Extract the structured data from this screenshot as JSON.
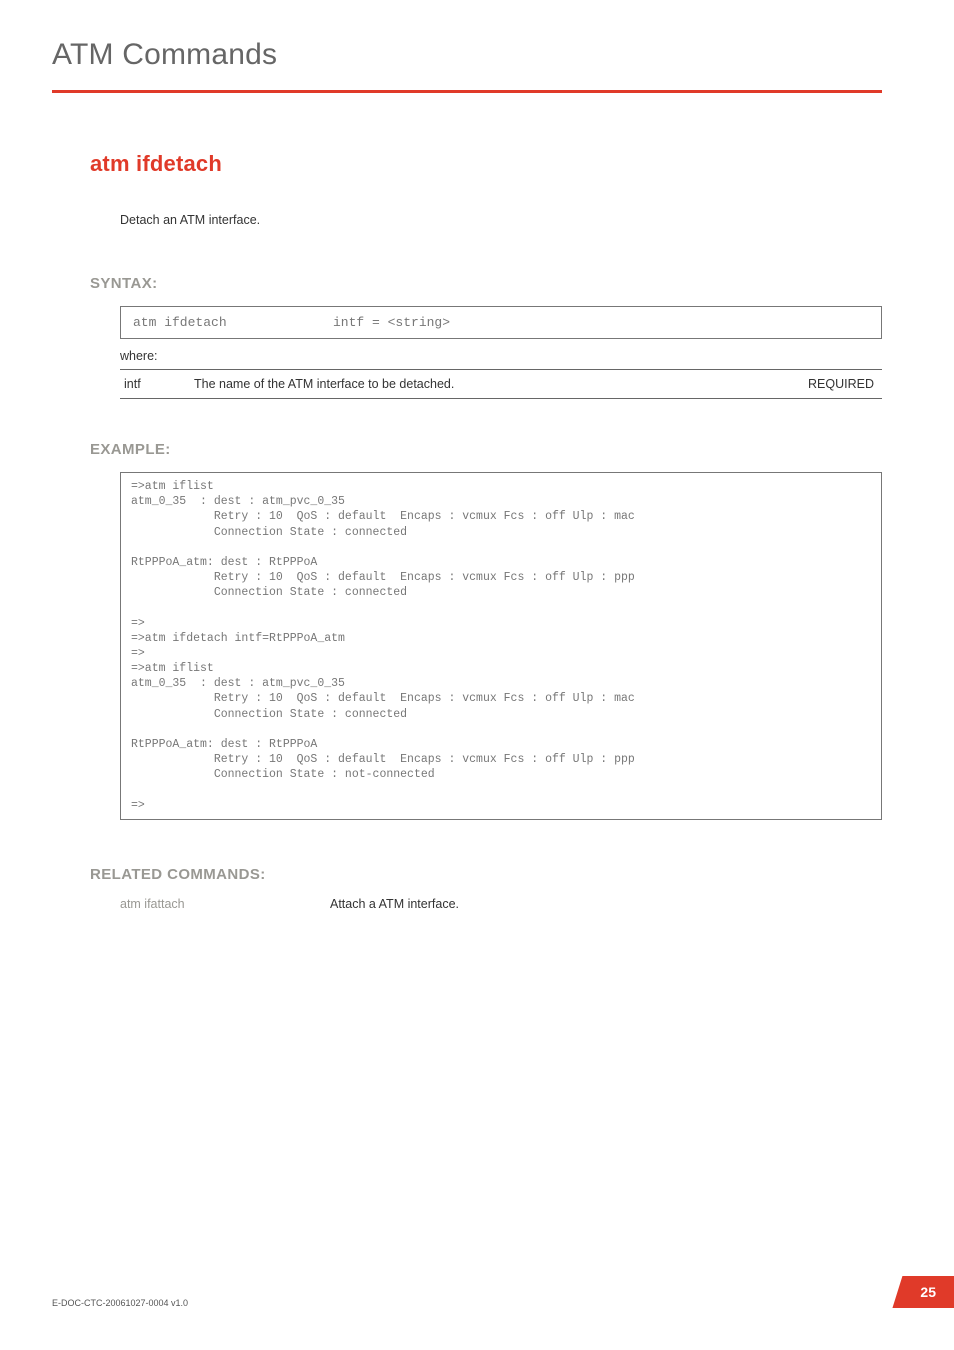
{
  "chapter_title": "ATM Commands",
  "command_name": "atm ifdetach",
  "description": "Detach an ATM interface.",
  "sections": {
    "syntax_head": "SYNTAX:",
    "example_head": "EXAMPLE:",
    "related_head": "RELATED COMMANDS:"
  },
  "syntax": {
    "left": "atm ifdetach",
    "right": "intf = <string>",
    "where_label": "where:",
    "param_name": "intf",
    "param_desc": "The name of the ATM interface to be detached.",
    "param_req": "REQUIRED"
  },
  "example_text": "=>atm iflist\natm_0_35  : dest : atm_pvc_0_35\n            Retry : 10  QoS : default  Encaps : vcmux Fcs : off Ulp : mac\n            Connection State : connected\n\nRtPPPoA_atm: dest : RtPPPoA\n            Retry : 10  QoS : default  Encaps : vcmux Fcs : off Ulp : ppp\n            Connection State : connected\n\n=>\n=>atm ifdetach intf=RtPPPoA_atm\n=>\n=>atm iflist\natm_0_35  : dest : atm_pvc_0_35\n            Retry : 10  QoS : default  Encaps : vcmux Fcs : off Ulp : mac\n            Connection State : connected\n\nRtPPPoA_atm: dest : RtPPPoA\n            Retry : 10  QoS : default  Encaps : vcmux Fcs : off Ulp : ppp\n            Connection State : not-connected\n\n=>",
  "related": {
    "cmd": "atm ifattach",
    "desc": "Attach a ATM interface."
  },
  "footer": {
    "doc_id": "E-DOC-CTC-20061027-0004 v1.0",
    "page_number": "25"
  }
}
